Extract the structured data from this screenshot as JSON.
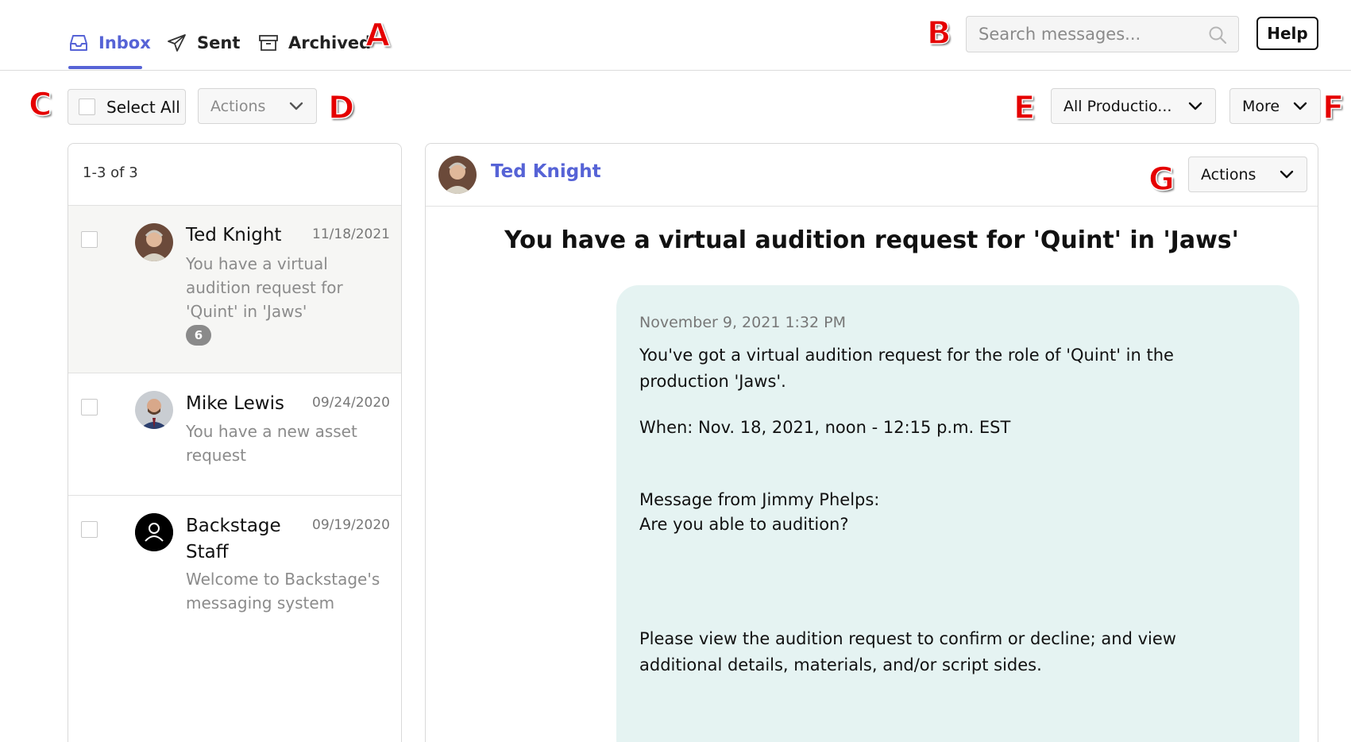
{
  "nav": {
    "tabs": [
      {
        "label": "Inbox",
        "icon": "inbox-icon",
        "active": true
      },
      {
        "label": "Sent",
        "icon": "paper-plane-icon",
        "active": false
      },
      {
        "label": "Archived",
        "icon": "archive-box-icon",
        "active": false
      }
    ],
    "search_placeholder": "Search messages...",
    "help_label": "Help"
  },
  "toolbar": {
    "select_all_label": "Select All",
    "actions_label": "Actions",
    "productions_label": "All Productio...",
    "more_label": "More"
  },
  "list": {
    "count_text": "1-3 of 3",
    "items": [
      {
        "name": "Ted Knight",
        "date": "11/18/2021",
        "preview": "You have a virtual audition request for 'Quint' in 'Jaws'",
        "badge": "6",
        "selected": true
      },
      {
        "name": "Mike Lewis",
        "date": "09/24/2020",
        "preview": "You have a new asset request",
        "badge": null,
        "selected": false
      },
      {
        "name": "Backstage Staff",
        "date": "09/19/2020",
        "preview": "Welcome to Backstage's messaging system",
        "badge": null,
        "selected": false
      }
    ]
  },
  "detail": {
    "sender": "Ted Knight",
    "actions_label": "Actions",
    "subject": "You have a virtual audition request for 'Quint' in 'Jaws'",
    "message": {
      "timestamp": "November 9, 2021 1:32 PM",
      "paragraphs": [
        "You've got a virtual audition request for the role of 'Quint' in the production 'Jaws'.",
        "When: Nov. 18, 2021, noon - 12:15 p.m. EST",
        "Message from Jimmy Phelps:",
        "Are you able to audition?",
        "Please view the audition request to confirm or decline; and view additional details, materials, and/or script sides."
      ]
    }
  },
  "annotations": {
    "a": "A",
    "b": "B",
    "c": "C",
    "d": "D",
    "e": "E",
    "f": "F",
    "g": "G"
  },
  "colors": {
    "accent": "#5663d6",
    "bubble": "#e5f3f2",
    "annotation": "#e50000",
    "badge": "#8a8a8a"
  }
}
